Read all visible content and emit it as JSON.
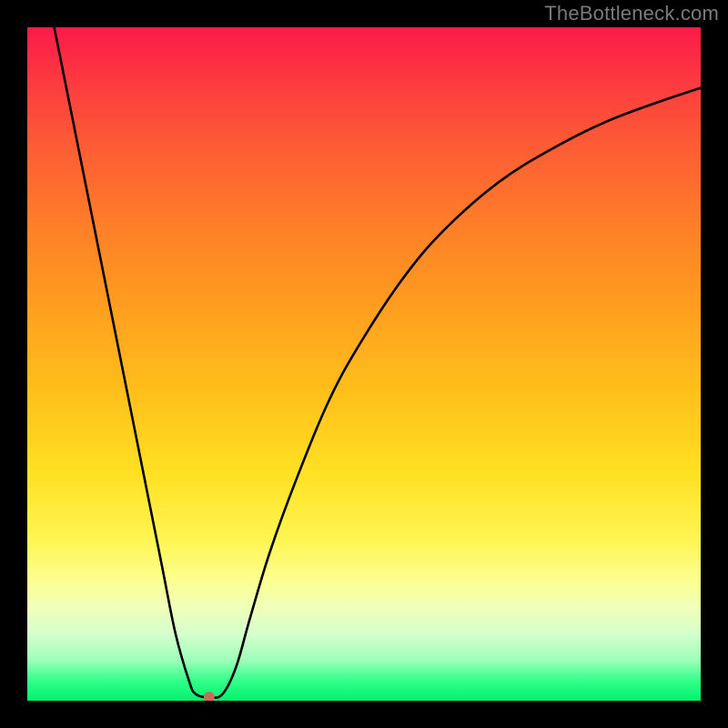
{
  "watermark": "TheBottleneck.com",
  "chart_data": {
    "type": "line",
    "title": "",
    "xlabel": "",
    "ylabel": "",
    "xlim": [
      0,
      100
    ],
    "ylim": [
      0,
      100
    ],
    "legend": null,
    "grid": false,
    "background": {
      "style": "vertical-gradient",
      "stops": [
        {
          "pos": 0.0,
          "color": "#fb1a49"
        },
        {
          "pos": 0.08,
          "color": "#fc3a3f"
        },
        {
          "pos": 0.18,
          "color": "#fd5d34"
        },
        {
          "pos": 0.3,
          "color": "#fe8028"
        },
        {
          "pos": 0.42,
          "color": "#ff9f1f"
        },
        {
          "pos": 0.54,
          "color": "#ffbf1a"
        },
        {
          "pos": 0.66,
          "color": "#ffe022"
        },
        {
          "pos": 0.76,
          "color": "#fff552"
        },
        {
          "pos": 0.82,
          "color": "#fcff8f"
        },
        {
          "pos": 0.86,
          "color": "#f1ffb8"
        },
        {
          "pos": 0.9,
          "color": "#d6ffcd"
        },
        {
          "pos": 0.94,
          "color": "#9cffb9"
        },
        {
          "pos": 0.97,
          "color": "#33ff8a"
        },
        {
          "pos": 1.0,
          "color": "#00f36e"
        }
      ]
    },
    "series": [
      {
        "name": "bottleneck-curve",
        "color": "#000000",
        "points": [
          {
            "x": 4,
            "y": 100
          },
          {
            "x": 6,
            "y": 90
          },
          {
            "x": 8,
            "y": 80
          },
          {
            "x": 10,
            "y": 70
          },
          {
            "x": 12,
            "y": 60
          },
          {
            "x": 14,
            "y": 50
          },
          {
            "x": 16,
            "y": 40
          },
          {
            "x": 18,
            "y": 30
          },
          {
            "x": 20,
            "y": 20
          },
          {
            "x": 22,
            "y": 10
          },
          {
            "x": 24,
            "y": 3
          },
          {
            "x": 25,
            "y": 1
          },
          {
            "x": 27,
            "y": 0.5
          },
          {
            "x": 29,
            "y": 1
          },
          {
            "x": 31,
            "y": 5
          },
          {
            "x": 33,
            "y": 12
          },
          {
            "x": 36,
            "y": 22
          },
          {
            "x": 40,
            "y": 33
          },
          {
            "x": 45,
            "y": 45
          },
          {
            "x": 50,
            "y": 54
          },
          {
            "x": 56,
            "y": 63
          },
          {
            "x": 62,
            "y": 70
          },
          {
            "x": 70,
            "y": 77
          },
          {
            "x": 78,
            "y": 82
          },
          {
            "x": 86,
            "y": 86
          },
          {
            "x": 94,
            "y": 89
          },
          {
            "x": 100,
            "y": 91
          }
        ]
      }
    ],
    "marker": {
      "x": 27,
      "y": 0.5,
      "color": "#c96b5a",
      "radius_px": 6
    }
  },
  "colors": {
    "frame": "#000000",
    "curve": "#000000",
    "marker": "#c96b5a"
  }
}
